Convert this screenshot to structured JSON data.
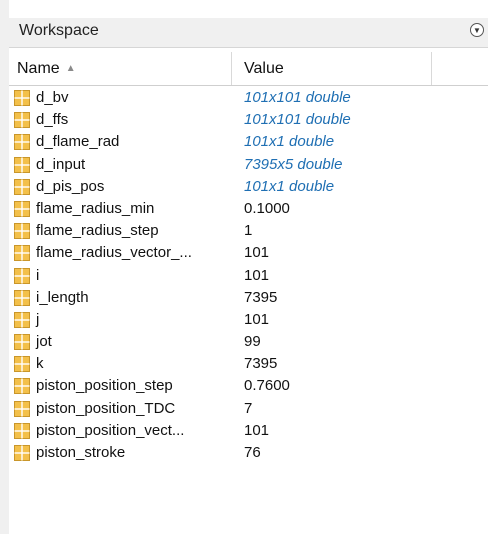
{
  "panel": {
    "title": "Workspace",
    "collapse_icon": "chevron-down-circle-icon"
  },
  "columns": {
    "name": "Name",
    "value": "Value",
    "sort_icon": "▲"
  },
  "variables": [
    {
      "name": "d_bv",
      "value": "101x101 double",
      "is_link": true
    },
    {
      "name": "d_ffs",
      "value": "101x101 double",
      "is_link": true
    },
    {
      "name": "d_flame_rad",
      "value": "101x1 double",
      "is_link": true
    },
    {
      "name": "d_input",
      "value": "7395x5 double",
      "is_link": true
    },
    {
      "name": "d_pis_pos",
      "value": "101x1 double",
      "is_link": true
    },
    {
      "name": "flame_radius_min",
      "value": "0.1000",
      "is_link": false
    },
    {
      "name": "flame_radius_step",
      "value": "1",
      "is_link": false
    },
    {
      "name": "flame_radius_vector_...",
      "value": "101",
      "is_link": false
    },
    {
      "name": "i",
      "value": "101",
      "is_link": false
    },
    {
      "name": "i_length",
      "value": "7395",
      "is_link": false
    },
    {
      "name": "j",
      "value": "101",
      "is_link": false
    },
    {
      "name": "jot",
      "value": "99",
      "is_link": false
    },
    {
      "name": "k",
      "value": "7395",
      "is_link": false
    },
    {
      "name": "piston_position_step",
      "value": "0.7600",
      "is_link": false
    },
    {
      "name": "piston_position_TDC",
      "value": "7",
      "is_link": false
    },
    {
      "name": "piston_position_vect...",
      "value": "101",
      "is_link": false
    },
    {
      "name": "piston_stroke",
      "value": "76",
      "is_link": false
    }
  ],
  "colors": {
    "icon_fill": "#f3c04a",
    "icon_grid": "#ffffff",
    "link_value": "#1f6fb3"
  }
}
